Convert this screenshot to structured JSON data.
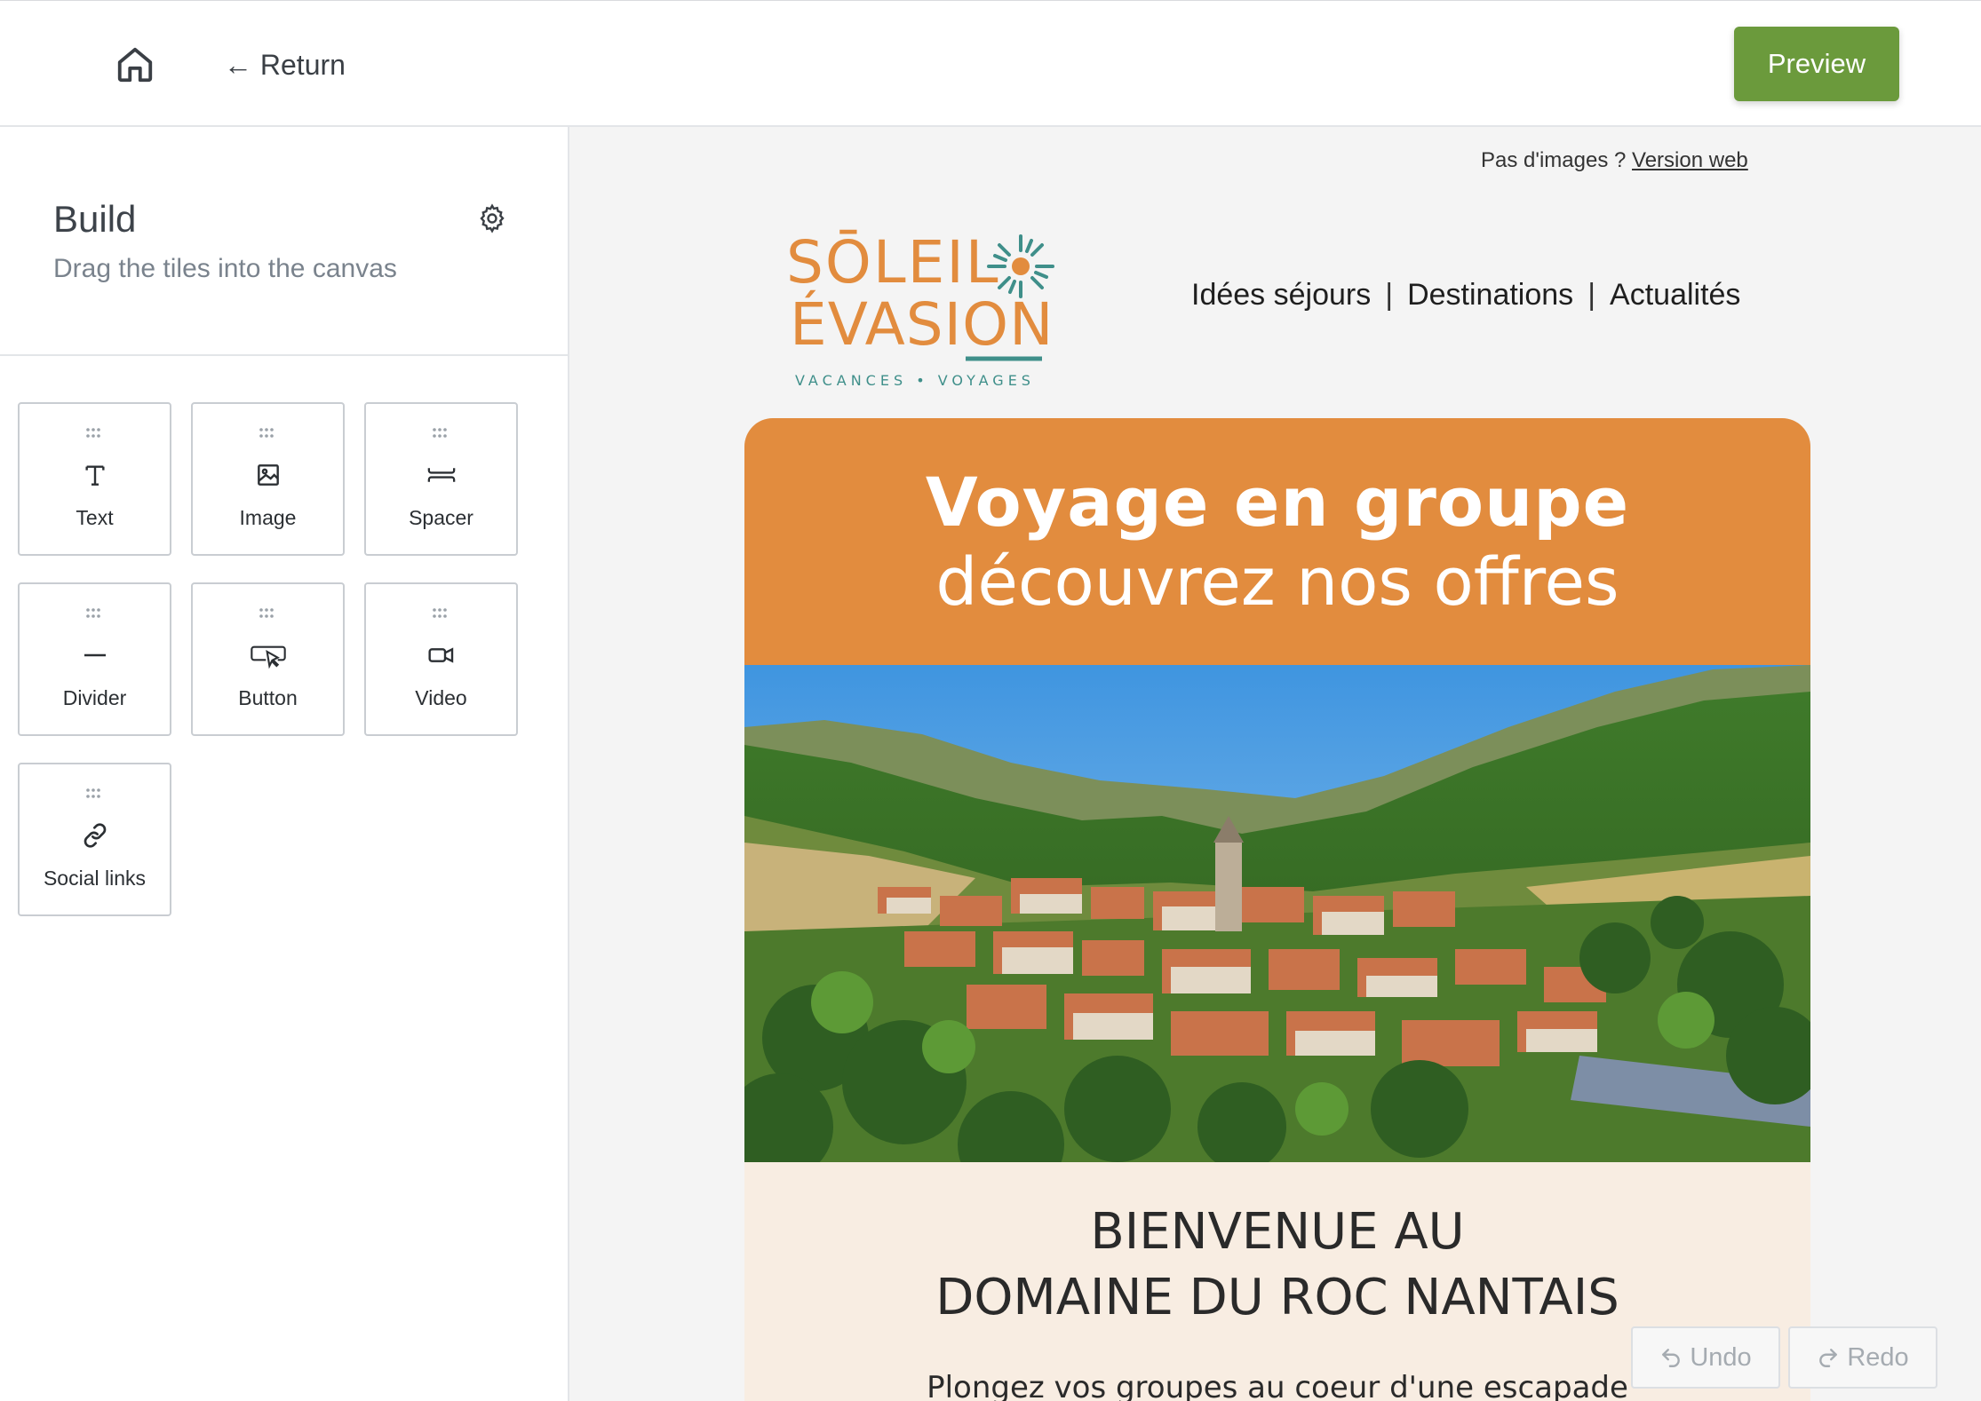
{
  "topbar": {
    "home_icon": "home-icon",
    "return_label": "← Return",
    "preview_label": "Preview"
  },
  "sidebar": {
    "title": "Build",
    "subtitle": "Drag the tiles into the canvas",
    "settings_icon": "gear-icon",
    "tiles": [
      {
        "label": "Text",
        "icon": "text-icon"
      },
      {
        "label": "Image",
        "icon": "image-icon"
      },
      {
        "label": "Spacer",
        "icon": "spacer-icon"
      },
      {
        "label": "Divider",
        "icon": "divider-icon"
      },
      {
        "label": "Button",
        "icon": "button-icon"
      },
      {
        "label": "Video",
        "icon": "video-icon"
      },
      {
        "label": "Social links",
        "icon": "link-icon"
      }
    ]
  },
  "email": {
    "no_images_text": "Pas d'images ? ",
    "web_version_link": "Version web",
    "logo": {
      "line1": "SŌLEIL",
      "line2": "ÉVASION",
      "tagline": "VACANCES • VOYAGES",
      "orange": "#e28c3e",
      "teal": "#3f8f8a"
    },
    "nav": [
      "Idées séjours",
      "Destinations",
      "Actualités"
    ],
    "nav_separator": "|",
    "hero_title": "Voyage en groupe",
    "hero_subtitle": "découvrez nos offres",
    "hero_color": "#e28c3e",
    "welcome_title_line1": "BIENVENUE AU",
    "welcome_title_line2": "DOMAINE DU ROC NANTAIS",
    "welcome_text": "Plongez vos groupes au coeur d'une escapade"
  },
  "history": {
    "undo_label": "Undo",
    "redo_label": "Redo"
  }
}
